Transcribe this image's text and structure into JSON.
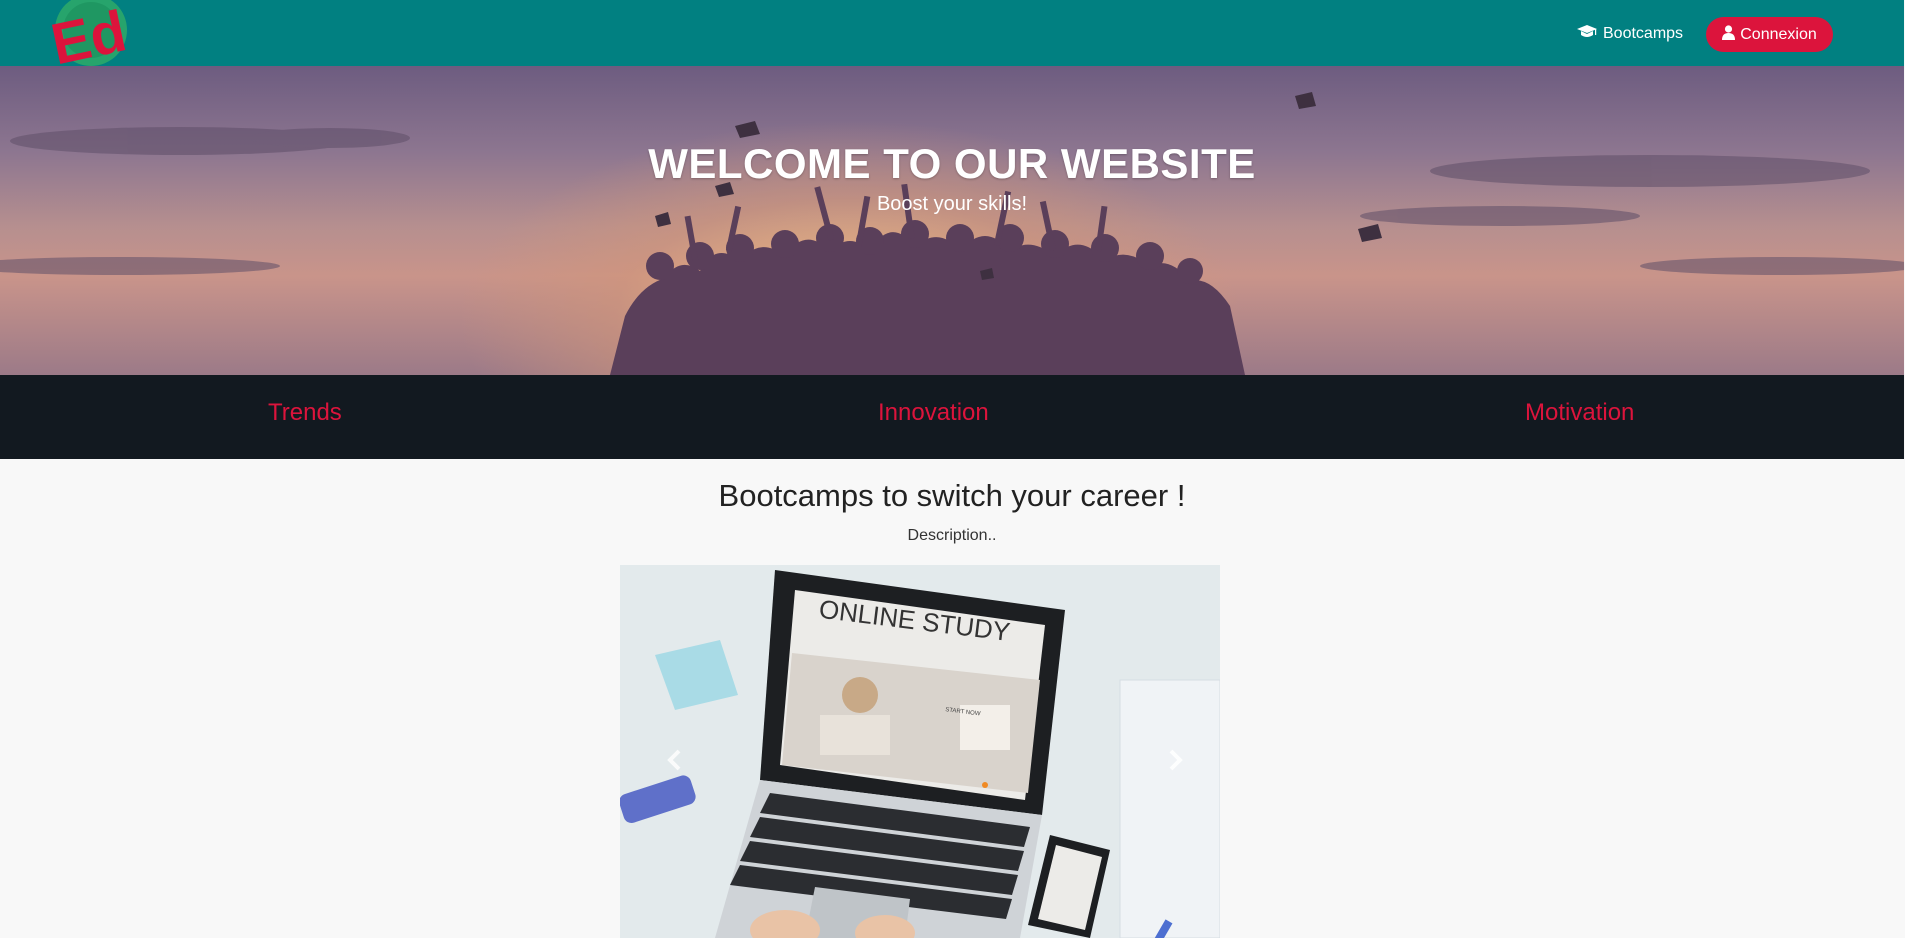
{
  "navbar": {
    "logo_text": "Ed",
    "links": [
      {
        "label": "Bootcamps",
        "icon": "graduation-cap-icon"
      }
    ],
    "connexion": {
      "label": "Connexion",
      "icon": "user-icon"
    }
  },
  "hero": {
    "title": "WELCOME TO OUR WEBSITE",
    "subtitle": "Boost your skills!"
  },
  "categories": [
    {
      "label": "Trends"
    },
    {
      "label": "Innovation"
    },
    {
      "label": "Motivation"
    }
  ],
  "section": {
    "title": "Bootcamps to switch your career !",
    "description": "Description.."
  },
  "carousel": {
    "slide_title": "ONLINE STUDY",
    "slide_button": "START NOW",
    "prev_icon": "chevron-left-icon",
    "next_icon": "chevron-right-icon"
  },
  "colors": {
    "navbar": "#018081",
    "accent": "#dc143c",
    "category_bar": "#121920"
  }
}
